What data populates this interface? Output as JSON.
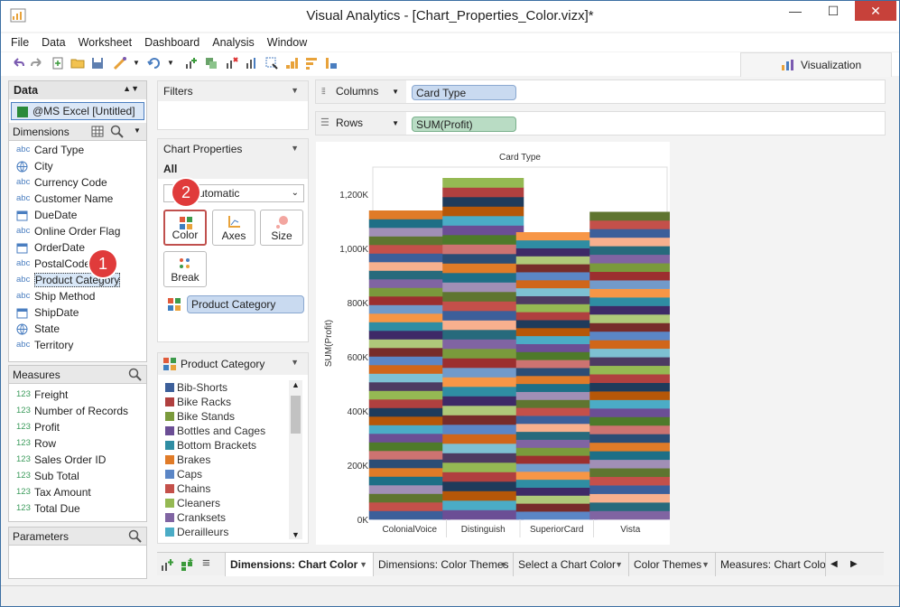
{
  "window": {
    "title": "Visual Analytics - [Chart_Properties_Color.vizx]*",
    "minimize": "—",
    "maximize": "☐",
    "close": "✕"
  },
  "menu": [
    "File",
    "Data",
    "Worksheet",
    "Dashboard",
    "Analysis",
    "Window"
  ],
  "visualization_tab": "Visualization",
  "data_panel": {
    "title": "Data",
    "source": "@MS Excel [Untitled]",
    "dimensions_label": "Dimensions",
    "dimensions": [
      {
        "type": "abc",
        "label": "Card Type"
      },
      {
        "type": "geo",
        "label": "City"
      },
      {
        "type": "abc",
        "label": "Currency Code"
      },
      {
        "type": "abc",
        "label": "Customer Name"
      },
      {
        "type": "date",
        "label": "DueDate"
      },
      {
        "type": "abc",
        "label": "Online Order Flag"
      },
      {
        "type": "date",
        "label": "OrderDate"
      },
      {
        "type": "abc",
        "label": "PostalCode"
      },
      {
        "type": "abc",
        "label": "Product Category"
      },
      {
        "type": "abc",
        "label": "Ship Method"
      },
      {
        "type": "date",
        "label": "ShipDate"
      },
      {
        "type": "geo",
        "label": "State"
      },
      {
        "type": "abc",
        "label": "Territory"
      }
    ],
    "measures_label": "Measures",
    "measures": [
      {
        "type": "123",
        "label": "Freight"
      },
      {
        "type": "123",
        "label": "Number of Records"
      },
      {
        "type": "123",
        "label": "Profit"
      },
      {
        "type": "123",
        "label": "Row"
      },
      {
        "type": "123",
        "label": "Sales Order ID"
      },
      {
        "type": "123",
        "label": "Sub Total"
      },
      {
        "type": "123",
        "label": "Tax Amount"
      },
      {
        "type": "123",
        "label": "Total Due"
      }
    ],
    "parameters_label": "Parameters"
  },
  "filters": {
    "title": "Filters"
  },
  "chart_properties": {
    "title": "Chart Properties",
    "scope": "All",
    "mark_type": "Automatic",
    "buttons": {
      "color": "Color",
      "axes": "Axes",
      "size": "Size",
      "break": "Break"
    },
    "color_field": "Product Category"
  },
  "legend": {
    "title": "Product Category",
    "items": [
      {
        "label": "Bib-Shorts",
        "color": "#3c5f9a"
      },
      {
        "label": "Bike Racks",
        "color": "#b0403f"
      },
      {
        "label": "Bike Stands",
        "color": "#7a9a3c"
      },
      {
        "label": "Bottles and Cages",
        "color": "#6b4e95"
      },
      {
        "label": "Bottom Brackets",
        "color": "#2f8da3"
      },
      {
        "label": "Brakes",
        "color": "#e07b28"
      },
      {
        "label": "Caps",
        "color": "#5b86c6"
      },
      {
        "label": "Chains",
        "color": "#c4504a"
      },
      {
        "label": "Cleaners",
        "color": "#95b953"
      },
      {
        "label": "Cranksets",
        "color": "#8064a2"
      },
      {
        "label": "Derailleurs",
        "color": "#4bacc6"
      }
    ]
  },
  "shelves": {
    "columns_label": "Columns",
    "columns_value": "Card Type",
    "rows_label": "Rows",
    "rows_value": "SUM(Profit)"
  },
  "chart_data": {
    "type": "bar",
    "stacked": true,
    "title": "Card Type",
    "ylabel": "SUM(Profit)",
    "categories": [
      "ColonialVoice",
      "Distinguish",
      "SuperiorCard",
      "Vista"
    ],
    "values": [
      1140000,
      1260000,
      1060000,
      1135000
    ],
    "ylim": [
      0,
      1300000
    ],
    "yticks": [
      "0K",
      "200K",
      "400K",
      "600K",
      "800K",
      "1,000K",
      "1,200K"
    ],
    "ytick_values": [
      0,
      200000,
      400000,
      600000,
      800000,
      1000000,
      1200000
    ]
  },
  "sheet_tabs": [
    "Dimensions: Chart Color",
    "Dimensions: Color Themes",
    "Select a Chart Color",
    "Color Themes",
    "Measures: Chart Colors"
  ],
  "callouts": [
    "1",
    "2"
  ]
}
